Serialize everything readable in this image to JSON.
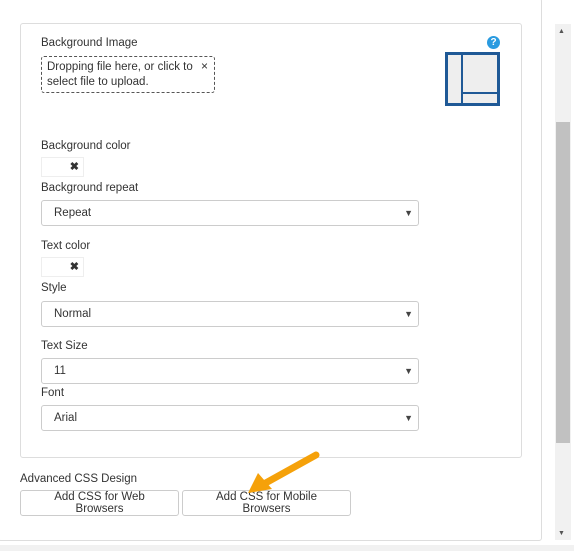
{
  "form": {
    "background_image": {
      "label": "Background Image",
      "drop_text": "Dropping file here, or click to select file to upload.",
      "clear": "×",
      "help": "?"
    },
    "background_color": {
      "label": "Background color",
      "clear": "✖"
    },
    "background_repeat": {
      "label": "Background repeat",
      "value": "Repeat"
    },
    "text_color": {
      "label": "Text color",
      "clear": "✖"
    },
    "style": {
      "label": "Style",
      "value": "Normal"
    },
    "text_size": {
      "label": "Text Size",
      "value": "11"
    },
    "font": {
      "label": "Font",
      "value": "Arial"
    }
  },
  "advanced": {
    "label": "Advanced CSS Design",
    "web_button": "Add CSS for Web Browsers",
    "mobile_button": "Add CSS for Mobile Browsers"
  },
  "colors": {
    "accent": "#1f5996",
    "help": "#2a9be0",
    "arrow": "#f5a10a"
  }
}
